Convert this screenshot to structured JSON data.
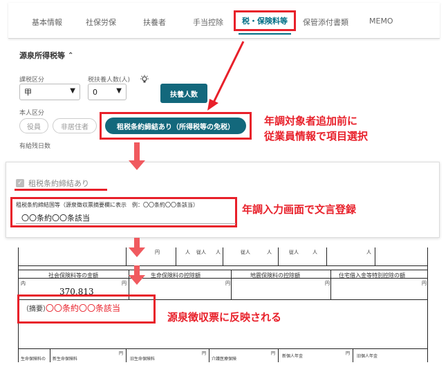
{
  "tabs": [
    "基本情報",
    "社保労保",
    "扶養者",
    "手当控除",
    "税・保険料等",
    "保管添付書類",
    "MEMO"
  ],
  "active_tab": "税・保険料等",
  "section": {
    "title": "源泉所得税等",
    "chevron": "^"
  },
  "tax_class": {
    "label": "課税区分",
    "value": "甲"
  },
  "dependents": {
    "label": "税扶養人数(人)",
    "value": "0"
  },
  "dependents_button": "扶養人数",
  "person_class": {
    "label": "本人区分",
    "chips": [
      "役員",
      "非居住者"
    ]
  },
  "treaty_pill": "租税条約締結あり（所得税等の免税）",
  "paid_leave_label": "有給残日数",
  "callout1": [
    "年調対象者追加前に",
    "従業員情報で項目選択"
  ],
  "panel2": {
    "checkbox_label": "租税条約締結あり",
    "field_label": "租税条約締結国等（源泉徴収票摘要欄に表示　例：〇〇条約〇〇条該当）",
    "field_value": "〇〇条約〇〇条該当"
  },
  "callout2": "年調入力画面で文言登録",
  "panel3": {
    "top_labels": [
      "円",
      "人",
      "従人",
      "人",
      "従人",
      "人",
      "従人",
      "人",
      "人"
    ],
    "col_headers": [
      "社会保険料等の金額",
      "生命保険料の控除額",
      "地震保険料の控除額",
      "住宅借入金等特別控除の額"
    ],
    "social_insurance_amount": "370,813",
    "unit_marks": [
      "内",
      "円",
      "円",
      "円",
      "円"
    ],
    "memo_label": "（摘要）",
    "memo_value": "〇〇条約〇〇条該当",
    "bottom_labels": [
      "生命保険料の",
      "新生命保険料",
      "円",
      "旧生命保険料",
      "円",
      "介護医療保険",
      "円",
      "新個人年金",
      "円",
      "旧個人年金"
    ]
  },
  "callout3": "源泉徴収票に反映される",
  "colors": {
    "accent_red": "#e8202a",
    "teal": "#13687c",
    "tab_active_text": "#006f86"
  },
  "icons": [
    "chevron-up-icon",
    "lightbulb-icon",
    "dropdown-arrow-icon",
    "checkmark-icon",
    "down-arrow-icon"
  ]
}
